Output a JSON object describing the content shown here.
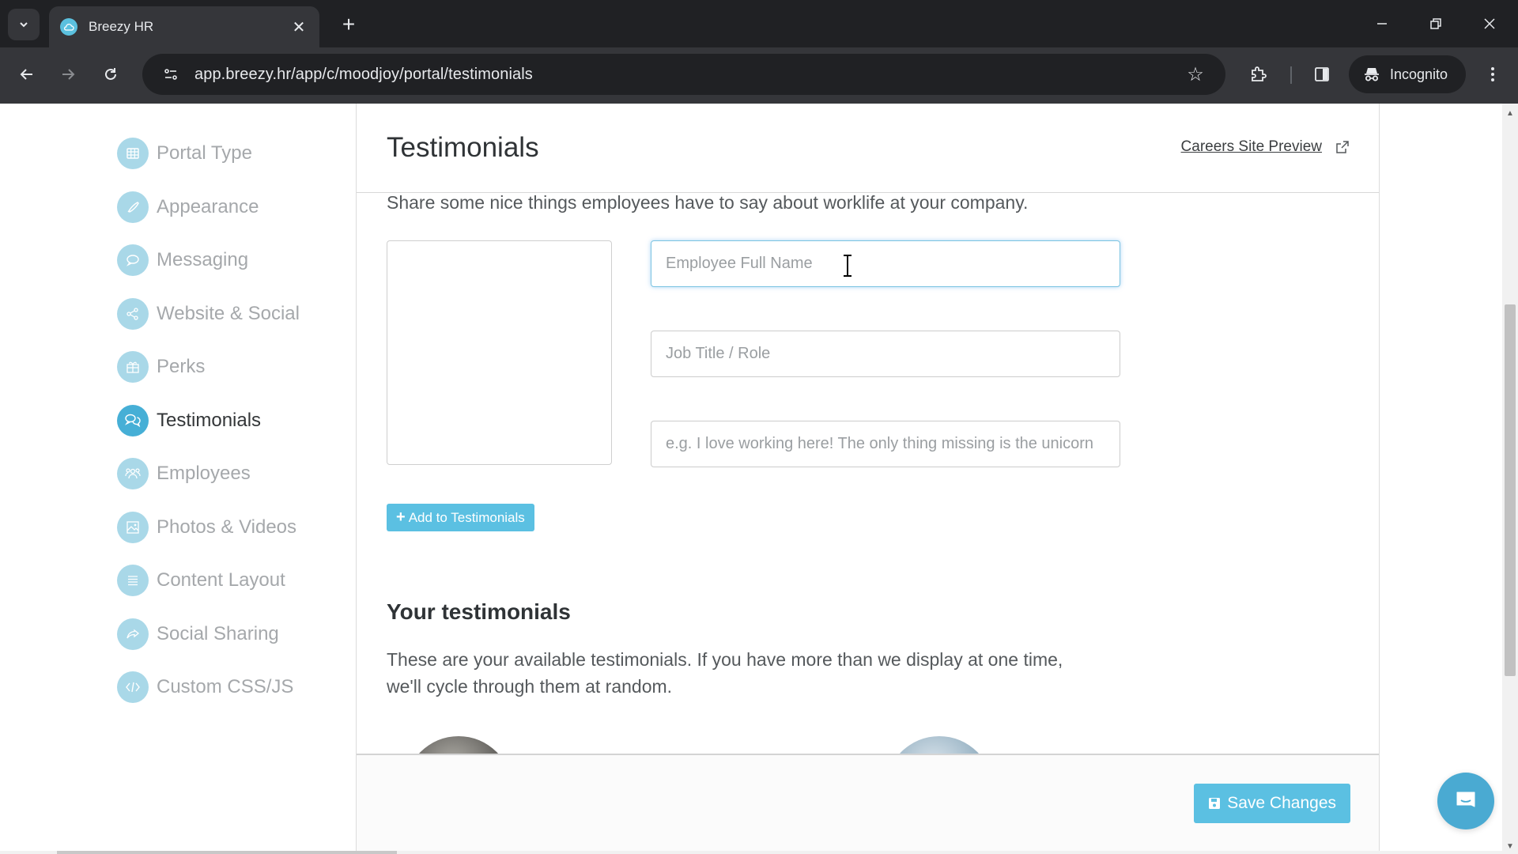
{
  "browser": {
    "tab_title": "Breezy HR",
    "url": "app.breezy.hr/app/c/moodjoy/portal/testimonials",
    "incognito_label": "Incognito",
    "favicon_color": "#5bc0de"
  },
  "sidebar": {
    "items": [
      {
        "label": "Portal Type",
        "icon": "grid-icon",
        "active": false
      },
      {
        "label": "Appearance",
        "icon": "brush-icon",
        "active": false
      },
      {
        "label": "Messaging",
        "icon": "chat-bubble-icon",
        "active": false
      },
      {
        "label": "Website & Social",
        "icon": "share-icon",
        "active": false
      },
      {
        "label": "Perks",
        "icon": "gift-icon",
        "active": false
      },
      {
        "label": "Testimonials",
        "icon": "chat-bubbles-icon",
        "active": true
      },
      {
        "label": "Employees",
        "icon": "users-icon",
        "active": false
      },
      {
        "label": "Photos & Videos",
        "icon": "image-icon",
        "active": false
      },
      {
        "label": "Content Layout",
        "icon": "list-icon",
        "active": false
      },
      {
        "label": "Social Sharing",
        "icon": "share-arrow-icon",
        "active": false
      },
      {
        "label": "Custom CSS/JS",
        "icon": "code-icon",
        "active": false
      }
    ]
  },
  "main": {
    "title": "Testimonials",
    "preview_link": "Careers Site Preview",
    "intro": "Share some nice things employees have to say about worklife at your company.",
    "form": {
      "name_placeholder": "Employee Full Name",
      "name_value": "",
      "role_placeholder": "Job Title / Role",
      "role_value": "",
      "quote_placeholder": "e.g. I love working here! The only thing missing is the unicorn",
      "quote_value": "",
      "add_button": "Add to Testimonials"
    },
    "your_testimonials": {
      "title": "Your testimonials",
      "description": "These are your available testimonials. If you have more than we display at one time, we'll cycle through them at random."
    },
    "save_button": "Save Changes"
  },
  "colors": {
    "accent": "#5bc0e2",
    "active_icon": "#46afd6",
    "inactive_icon": "#a9d8e8"
  }
}
